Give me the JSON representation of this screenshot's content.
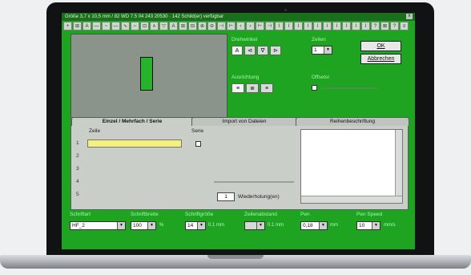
{
  "window": {
    "title": "Größe 3,7 x 10,5 mm / 82 WD 7.5 04 243 20530 · 142 Schild(er) verfügbar",
    "close_label": "x"
  },
  "toolbar": {
    "buttons": [
      "+",
      "⊞",
      "A",
      "—",
      "~",
      "—",
      "∿",
      "∼",
      "⊡",
      "∧",
      "▽",
      "A",
      "⊞",
      "⊟",
      "⊕",
      "⊖",
      "⊣",
      "⊢",
      "‹",
      "›",
      "⊢",
      "⊣",
      "ǀ",
      "ǀ",
      "ǀ",
      "ǀ",
      "ǀ",
      "ǀ",
      "ǀ",
      "ǀ",
      "ǀ",
      "ǀ",
      "?",
      "⊠",
      "?",
      "≡"
    ]
  },
  "orientation": {
    "label": "Drehwinkel",
    "buttons": [
      "A",
      "⊲",
      "∇",
      "⊳"
    ]
  },
  "lines": {
    "label": "Zeilen",
    "value": "1"
  },
  "alignment": {
    "label": "Ausrichtung",
    "buttons": [
      "≡",
      "≣",
      "≡"
    ]
  },
  "offset": {
    "label": "Offsetsi"
  },
  "actions": {
    "ok": "OK",
    "cancel": "Abbrechen"
  },
  "tabs": [
    "Einzel / Mehrfach / Serie",
    "Import von Dateien",
    "Reihenbeschriftung"
  ],
  "entry": {
    "col_line": "Zeile",
    "col_series": "Serie",
    "row_numbers": [
      "1",
      "2",
      "3",
      "4",
      "5"
    ],
    "repeat_value": "1",
    "repeat_label": "Wiederholung(en)"
  },
  "bottom": {
    "fields": [
      {
        "label": "Schriftart",
        "value": "HF_2",
        "unit": ""
      },
      {
        "label": "Schriftbreite",
        "value": "100",
        "unit": "%"
      },
      {
        "label": "Schriftgröße",
        "value": "14",
        "unit": "0.1 mm"
      },
      {
        "label": "Zeilenabstand",
        "value": "",
        "unit": "0.1 mm"
      },
      {
        "label": "Pen",
        "value": "0,18",
        "unit": "mm"
      },
      {
        "label": "Pen Speed",
        "value": "10",
        "unit": "mm/s"
      }
    ]
  }
}
